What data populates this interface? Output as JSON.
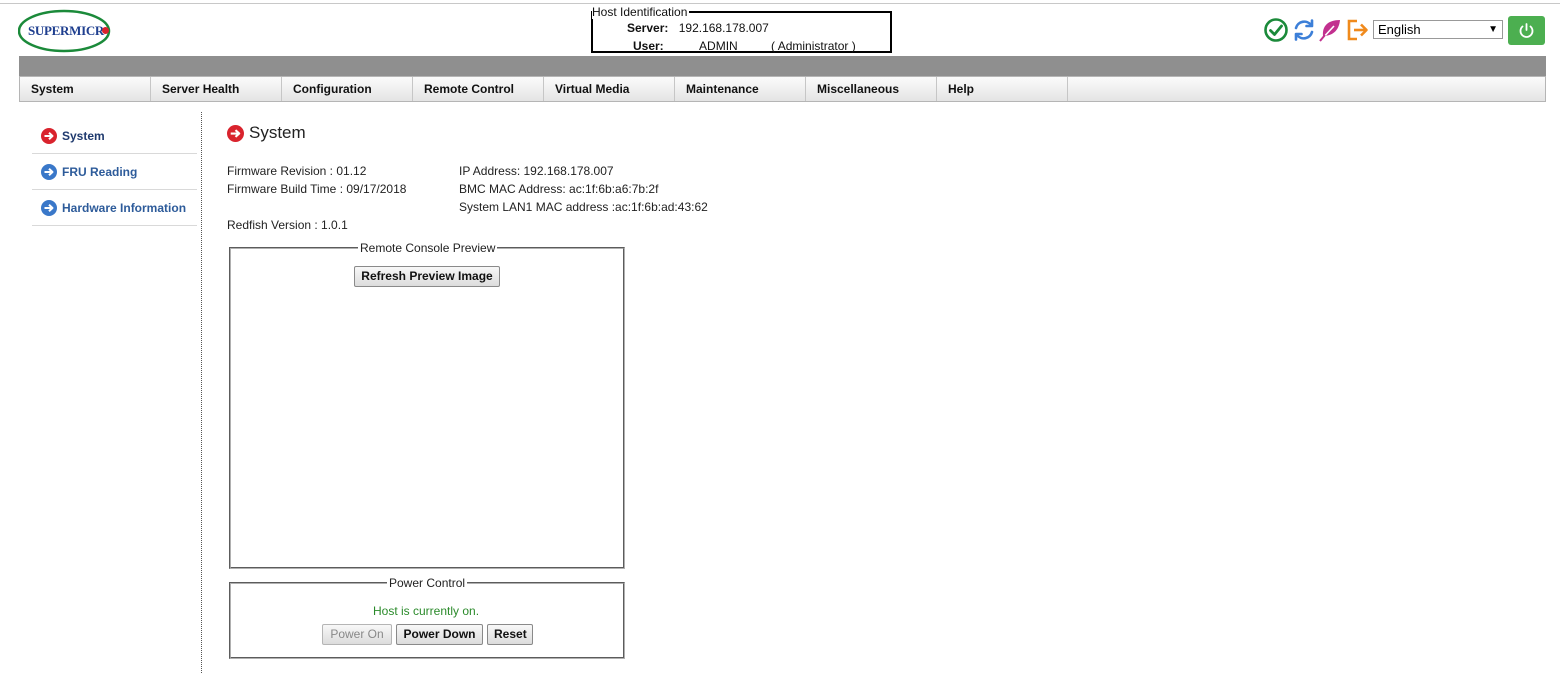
{
  "logo": {
    "text": "SUPERMICR"
  },
  "host": {
    "legend": "Host Identification",
    "server_label": "Server:",
    "server_value": "192.168.178.007",
    "user_label": "User:",
    "user_value": "ADMIN",
    "user_role": "( Administrator )"
  },
  "toolbar": {
    "language": "English",
    "icons": [
      "check-circle-icon",
      "refresh-icon",
      "leaf-icon",
      "logout-icon",
      "power-icon"
    ]
  },
  "nav": [
    "System",
    "Server Health",
    "Configuration",
    "Remote Control",
    "Virtual Media",
    "Maintenance",
    "Miscellaneous",
    "Help"
  ],
  "sidebar": {
    "items": [
      {
        "label": "System",
        "active": true
      },
      {
        "label": "FRU Reading",
        "active": false
      },
      {
        "label": "Hardware Information",
        "active": false
      }
    ]
  },
  "main": {
    "title": "System",
    "firmware_revision": "Firmware Revision :  01.12",
    "firmware_build_time": "Firmware Build Time :  09/17/2018",
    "redfish_version": "Redfish Version : 1.0.1",
    "ip_address": "IP Address:  192.168.178.007",
    "bmc_mac": "BMC MAC Address:  ac:1f:6b:a6:7b:2f",
    "lan1_mac": "System LAN1 MAC address :ac:1f:6b:ad:43:62"
  },
  "preview": {
    "legend": "Remote Console Preview",
    "refresh_label": "Refresh Preview Image"
  },
  "power": {
    "legend": "Power Control",
    "status": "Host is currently on.",
    "power_on_label": "Power On",
    "power_down_label": "Power Down",
    "reset_label": "Reset"
  },
  "colors": {
    "accent_green": "#4caf50",
    "active_red": "#d9232d",
    "link_blue": "#2d5b9a",
    "status_green": "#2a8a2a"
  }
}
